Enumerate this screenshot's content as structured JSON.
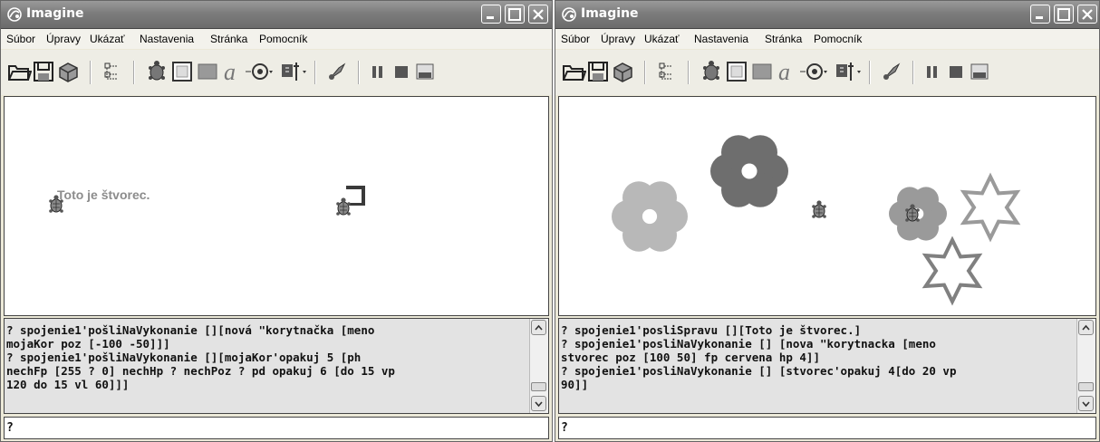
{
  "windows": [
    {
      "title": "Imagine",
      "menu": [
        "Súbor",
        "Úpravy",
        "Ukázať",
        "Nastavenia",
        "Stránka",
        "Pomocník"
      ],
      "canvas_text": "Toto je štvorec.",
      "console_lines": [
        "? spojenie1'pošliNaVykonanie [][nová \"korytnačka [meno",
        "mojaKor poz [-100 -50]]]",
        "? spojenie1'pošliNaVykonanie [][mojaKor'opakuj 5 [ph",
        "nechFp [255 ? 0] nechHp ? nechPoz ? pd opakuj 6 [do 15 vp",
        "120 do 15 vl 60]]]"
      ],
      "command_line": "?"
    },
    {
      "title": "Imagine",
      "menu": [
        "Súbor",
        "Úpravy",
        "Ukázať",
        "Nastavenia",
        "Stránka",
        "Pomocník"
      ],
      "console_lines": [
        "? spojenie1'posliSpravu [][Toto je štvorec.]",
        "? spojenie1'posliNaVykonanie [] [nova \"korytnacka [meno",
        "stvorec poz [100 50] fp cervena hp 4]]",
        "? spojenie1'posliNaVykonanie [] [stvorec'opakuj 4[do 20 vp",
        "90]]"
      ],
      "command_line": "?"
    }
  ],
  "colors": {
    "flower_light": "#b8b8b8",
    "flower_dark": "#6e6e6e",
    "star_light": "#9a9a9a",
    "star_dark": "#808080",
    "square_stroke": "#3a3a3a"
  },
  "icons": [
    "open-folder-icon",
    "save-icon",
    "pack-icon",
    "project-tree-icon",
    "turtle-icon",
    "frame-icon",
    "rect-icon",
    "text-icon",
    "joystick-icon",
    "sound-icon",
    "tools-icon",
    "pause-icon",
    "stop-icon",
    "run-icon"
  ]
}
